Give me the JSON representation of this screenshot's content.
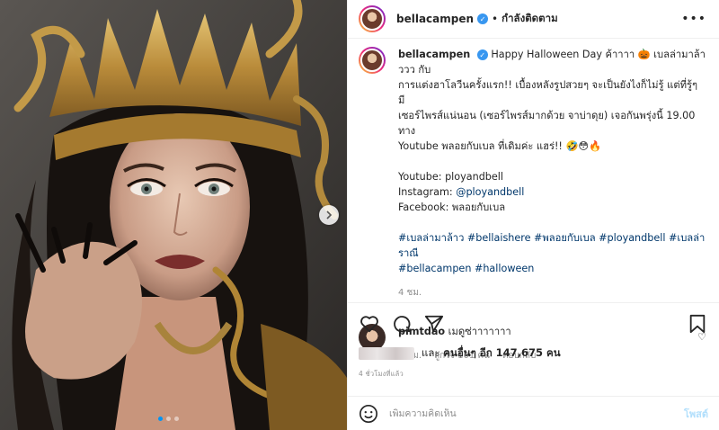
{
  "post": {
    "author": "bellacampen",
    "follow_separator": "•",
    "follow_status": "กำลังติดตาม",
    "more_icon": "more-horizontal-icon",
    "verified_icon": "verified-badge-icon"
  },
  "caption": {
    "author": "bellacampen",
    "text_lines": [
      "Happy Halloween Day ค้าาาา 🎃 เบลล่ามาล้าววว กับ",
      "การแต่งฮาโลวีนครั้งแรก!! เบื้องหลังรูปสวยๆ จะเป็นยังไงก็ไม่รู้ แต่ที่รู้ๆ มี",
      "เซอร์ไพรส์แน่นอน (เซอร์ไพรส์มากด้วย จาบ่าดุย) เจอกันพรุ่งนี้ 19.00 ทาง",
      "Youtube พลอยกับเบล ที่เดิมค่ะ แฮร่!! 🤣😳🔥"
    ],
    "youtube_label": "Youtube: ployandbell",
    "instagram_prefix": "Instagram: ",
    "instagram_handle": "@ployandbell",
    "facebook_label": "Facebook: พลอยกับเบล",
    "hashtags_line1": "#เบลล่ามาล้าว #bellaishere #พลอยกับเบล #ployandbell #เบลล่าราณี",
    "hashtags_line2": "#bellacampen #halloween",
    "time": "4 ชม."
  },
  "reply": {
    "author": "pimtdao",
    "text": "เมดูซ่าาาาาาา",
    "time": "4 ชม.",
    "likes": "ถูกใจ 101 คน",
    "reply_label": "ตอบกลับ"
  },
  "likes_summary": {
    "prefix": "และ",
    "others_label": "คนอื่นๆ อีก 147,675 คน"
  },
  "post_time": "4 ชั่วโมงที่แล้ว",
  "add_comment": {
    "placeholder": "เพิ่มความคิดเห็น",
    "post_label": "โพสต์"
  },
  "carousel": {
    "dot_count": 3,
    "active_index": 0
  },
  "colors": {
    "link": "#00376b",
    "verified": "#3897f0",
    "post_button_disabled": "#b2dffc",
    "carousel_active": "#0095f6"
  }
}
